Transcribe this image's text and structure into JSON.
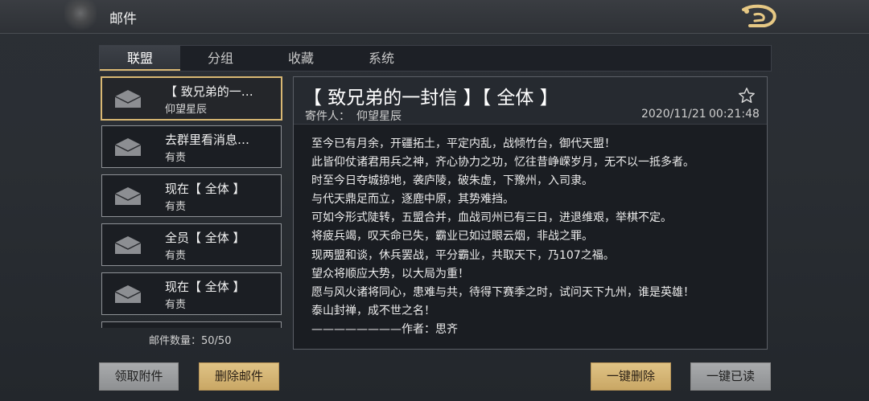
{
  "header": {
    "title": "邮件"
  },
  "tabs": [
    {
      "label": "联盟",
      "active": true
    },
    {
      "label": "分组",
      "active": false
    },
    {
      "label": "收藏",
      "active": false
    },
    {
      "label": "系统",
      "active": false
    }
  ],
  "mail_list": [
    {
      "subject": "【 致兄弟的一…",
      "sender": "仰望星辰",
      "selected": true,
      "icon": "envelope-icon"
    },
    {
      "subject": "去群里看消息…",
      "sender": "有责",
      "selected": false,
      "icon": "envelope-icon"
    },
    {
      "subject": "现在【 全体 】",
      "sender": "有责",
      "selected": false,
      "icon": "envelope-icon"
    },
    {
      "subject": "全员【 全体 】",
      "sender": "有责",
      "selected": false,
      "icon": "envelope-icon"
    },
    {
      "subject": "现在【 全体 】",
      "sender": "有责",
      "selected": false,
      "icon": "envelope-icon"
    }
  ],
  "mail_count": "邮件数量：50/50",
  "detail": {
    "title": "【 致兄弟的一封信 】【 全体 】",
    "sender_label": "寄件人：",
    "sender": "仰望星辰",
    "date": "2020/11/21",
    "time": "00:21:48",
    "body": [
      " 至今已有月余，开疆拓土，平定内乱，战倾竹台，御代天盟！",
      " 此皆仰仗诸君用兵之神，齐心协力之功，忆往昔峥嵘岁月，无不以一抵多者。",
      " 时至今日夺城掠地，袭庐陵，破朱虚，下豫州，入司隶。",
      "与代天鼎足而立，逐鹿中原，其势难挡。",
      " 可如今形式陡转，五盟合并，血战司州已有三日，进退维艰，举棋不定。",
      "将疲兵竭，叹天命已失，霸业已如过眼云烟，非战之罪。",
      "现两盟和谈，休兵罢战，平分霸业，共取天下，乃107之福。",
      "望众将顺应大势，以大局为重！",
      "愿与风火诸将同心，患难与共，待得下赛季之时，试问天下九州，谁是英雄！",
      "泰山封禅，成不世之名！",
      "————————作者：思齐"
    ]
  },
  "buttons": {
    "claim_attachments": "领取附件",
    "delete_mail": "删除邮件",
    "delete_all": "一键删除",
    "mark_all_read": "一键已读"
  },
  "colors": {
    "accent_gold": "#d9b873",
    "background": "#2a2e33"
  }
}
